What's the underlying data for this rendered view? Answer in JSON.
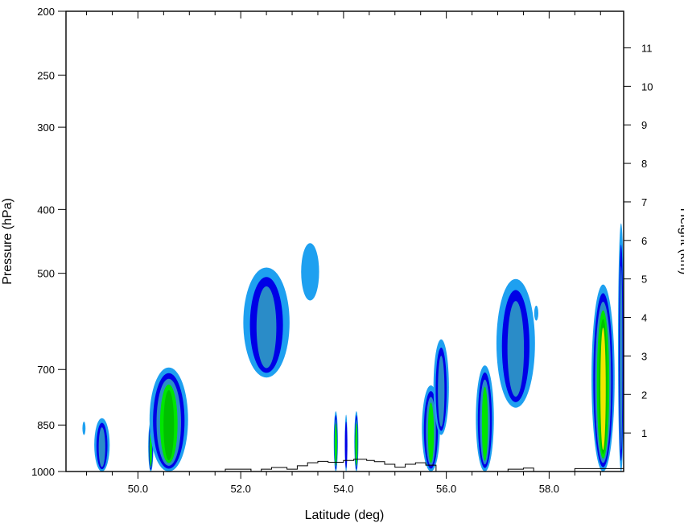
{
  "chart_data": {
    "type": "contour",
    "xlabel": "Latitude (deg)",
    "ylabel": "Pressure (hPa)",
    "y2label": "Height (km)",
    "xlim": [
      48.6,
      59.45
    ],
    "ylim": [
      200,
      1000
    ],
    "y2lim": [
      0,
      11.95
    ],
    "x_ticks": [
      "50.0",
      "52.0",
      "54.0",
      "56.0",
      "58.0"
    ],
    "x_tick_values": [
      50.0,
      52.0,
      54.0,
      56.0,
      58.0
    ],
    "y_ticks": [
      "200",
      "250",
      "300",
      "400",
      "500",
      "700",
      "850",
      "1000"
    ],
    "y_tick_values": [
      200,
      250,
      300,
      400,
      500,
      700,
      850,
      1000
    ],
    "y2_ticks": [
      "1",
      "2",
      "3",
      "4",
      "5",
      "6",
      "7",
      "8",
      "9",
      "10",
      "11"
    ],
    "y2_tick_values": [
      1,
      2,
      3,
      4,
      5,
      6,
      7,
      8,
      9,
      10,
      11
    ],
    "levels": [
      {
        "color": "#1ea0f0"
      },
      {
        "color": "#0000e6"
      },
      {
        "color": "#2a8cc8"
      },
      {
        "color": "#00e600"
      },
      {
        "color": "#00c000"
      },
      {
        "color": "#f0e600"
      }
    ],
    "cells": [
      {
        "lat": 48.95,
        "p_top": 840,
        "p_bot": 880,
        "w": 0.06,
        "level": 1
      },
      {
        "lat": 49.3,
        "p_top": 830,
        "p_bot": 1000,
        "w": 0.3,
        "level": 3
      },
      {
        "lat": 50.25,
        "p_top": 840,
        "p_bot": 1000,
        "w": 0.1,
        "level": 4
      },
      {
        "lat": 50.6,
        "p_top": 695,
        "p_bot": 1000,
        "w": 0.75,
        "level": 5
      },
      {
        "lat": 52.5,
        "p_top": 490,
        "p_bot": 720,
        "w": 0.9,
        "level": 3
      },
      {
        "lat": 53.35,
        "p_top": 450,
        "p_bot": 550,
        "w": 0.35,
        "level": 1
      },
      {
        "lat": 53.85,
        "p_top": 810,
        "p_bot": 1000,
        "w": 0.08,
        "level": 4
      },
      {
        "lat": 54.05,
        "p_top": 820,
        "p_bot": 1000,
        "w": 0.05,
        "level": 2
      },
      {
        "lat": 54.25,
        "p_top": 810,
        "p_bot": 1000,
        "w": 0.08,
        "level": 4
      },
      {
        "lat": 55.7,
        "p_top": 740,
        "p_bot": 1000,
        "w": 0.35,
        "level": 4
      },
      {
        "lat": 55.9,
        "p_top": 630,
        "p_bot": 880,
        "w": 0.3,
        "level": 3
      },
      {
        "lat": 56.75,
        "p_top": 690,
        "p_bot": 1000,
        "w": 0.35,
        "level": 4
      },
      {
        "lat": 57.35,
        "p_top": 510,
        "p_bot": 800,
        "w": 0.75,
        "level": 3
      },
      {
        "lat": 57.75,
        "p_top": 560,
        "p_bot": 590,
        "w": 0.08,
        "level": 1
      },
      {
        "lat": 59.05,
        "p_top": 520,
        "p_bot": 1000,
        "w": 0.45,
        "level": 6
      },
      {
        "lat": 59.4,
        "p_top": 420,
        "p_bot": 1000,
        "w": 0.12,
        "level": 3
      }
    ],
    "terrain": [
      [
        51.5,
        1000
      ],
      [
        51.7,
        992
      ],
      [
        52.0,
        992
      ],
      [
        52.2,
        1000
      ],
      [
        52.4,
        992
      ],
      [
        52.6,
        986
      ],
      [
        52.9,
        992
      ],
      [
        53.1,
        980
      ],
      [
        53.3,
        970
      ],
      [
        53.5,
        965
      ],
      [
        53.7,
        968
      ],
      [
        54.0,
        962
      ],
      [
        54.2,
        958
      ],
      [
        54.45,
        962
      ],
      [
        54.6,
        966
      ],
      [
        54.8,
        975
      ],
      [
        55.0,
        985
      ],
      [
        55.2,
        975
      ],
      [
        55.4,
        970
      ],
      [
        55.6,
        978
      ],
      [
        55.8,
        1000
      ],
      [
        57.2,
        992
      ],
      [
        57.5,
        988
      ],
      [
        57.7,
        1000
      ],
      [
        58.5,
        990
      ],
      [
        59.45,
        990
      ]
    ]
  }
}
